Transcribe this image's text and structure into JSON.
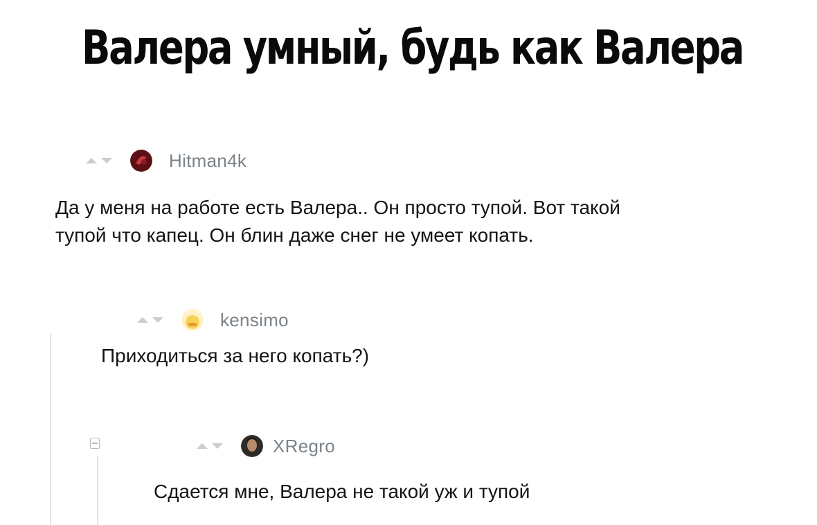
{
  "title": "Валера умный, будь как Валера",
  "comments": [
    {
      "username": "Hitman4k",
      "avatar_icon": "dark-red-avatar-icon",
      "text_lines": [
        "Да у меня на работе есть Валера.. Он просто тупой. Вот такой",
        "тупой что капец. Он блин даже  снег не умеет копать."
      ]
    },
    {
      "username": "kensimo",
      "avatar_icon": "yellow-cat-avatar-icon",
      "text_lines": [
        "Приходиться за него копать?)"
      ]
    },
    {
      "username": "XRegro",
      "avatar_icon": "person-avatar-icon",
      "text_lines": [
        "Сдается мне, Валера не такой уж и тупой"
      ]
    }
  ],
  "colors": {
    "vote_arrow": "#c9cdd2",
    "username": "#7b8289",
    "text": "#141414"
  }
}
